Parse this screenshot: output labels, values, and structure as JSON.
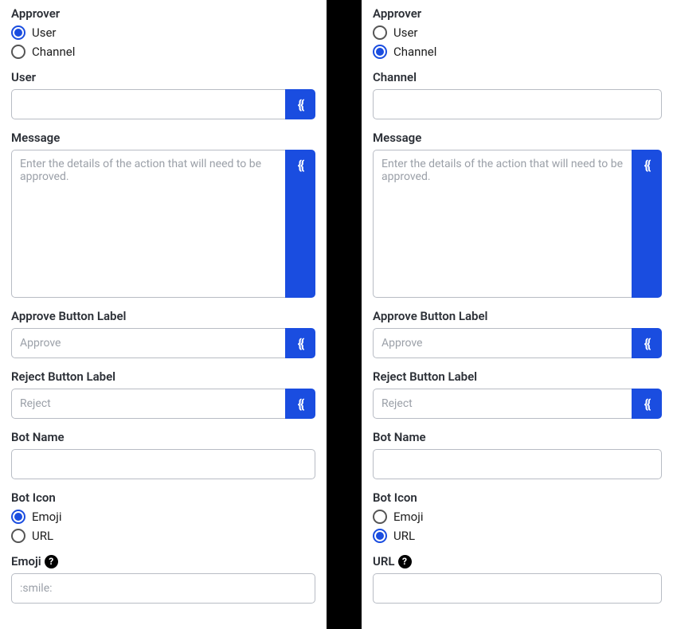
{
  "left": {
    "approver": {
      "label": "Approver",
      "options": [
        {
          "label": "User",
          "checked": true
        },
        {
          "label": "Channel",
          "checked": false
        }
      ],
      "target_label": "User"
    },
    "message": {
      "label": "Message",
      "placeholder": "Enter the details of the action that will need to be approved."
    },
    "approve": {
      "label": "Approve Button Label",
      "placeholder": "Approve"
    },
    "reject": {
      "label": "Reject Button Label",
      "placeholder": "Reject"
    },
    "botname": {
      "label": "Bot Name"
    },
    "boticon": {
      "label": "Bot Icon",
      "options": [
        {
          "label": "Emoji",
          "checked": true
        },
        {
          "label": "URL",
          "checked": false
        }
      ],
      "target_label": "Emoji",
      "placeholder": ":smile:"
    }
  },
  "right": {
    "approver": {
      "label": "Approver",
      "options": [
        {
          "label": "User",
          "checked": false
        },
        {
          "label": "Channel",
          "checked": true
        }
      ],
      "target_label": "Channel"
    },
    "message": {
      "label": "Message",
      "placeholder": "Enter the details of the action that will need to be approved."
    },
    "approve": {
      "label": "Approve Button Label",
      "placeholder": "Approve"
    },
    "reject": {
      "label": "Reject Button Label",
      "placeholder": "Reject"
    },
    "botname": {
      "label": "Bot Name"
    },
    "boticon": {
      "label": "Bot Icon",
      "options": [
        {
          "label": "Emoji",
          "checked": false
        },
        {
          "label": "URL",
          "checked": true
        }
      ],
      "target_label": "URL",
      "placeholder": ""
    }
  },
  "merge_glyph": "{{",
  "help_glyph": "?"
}
